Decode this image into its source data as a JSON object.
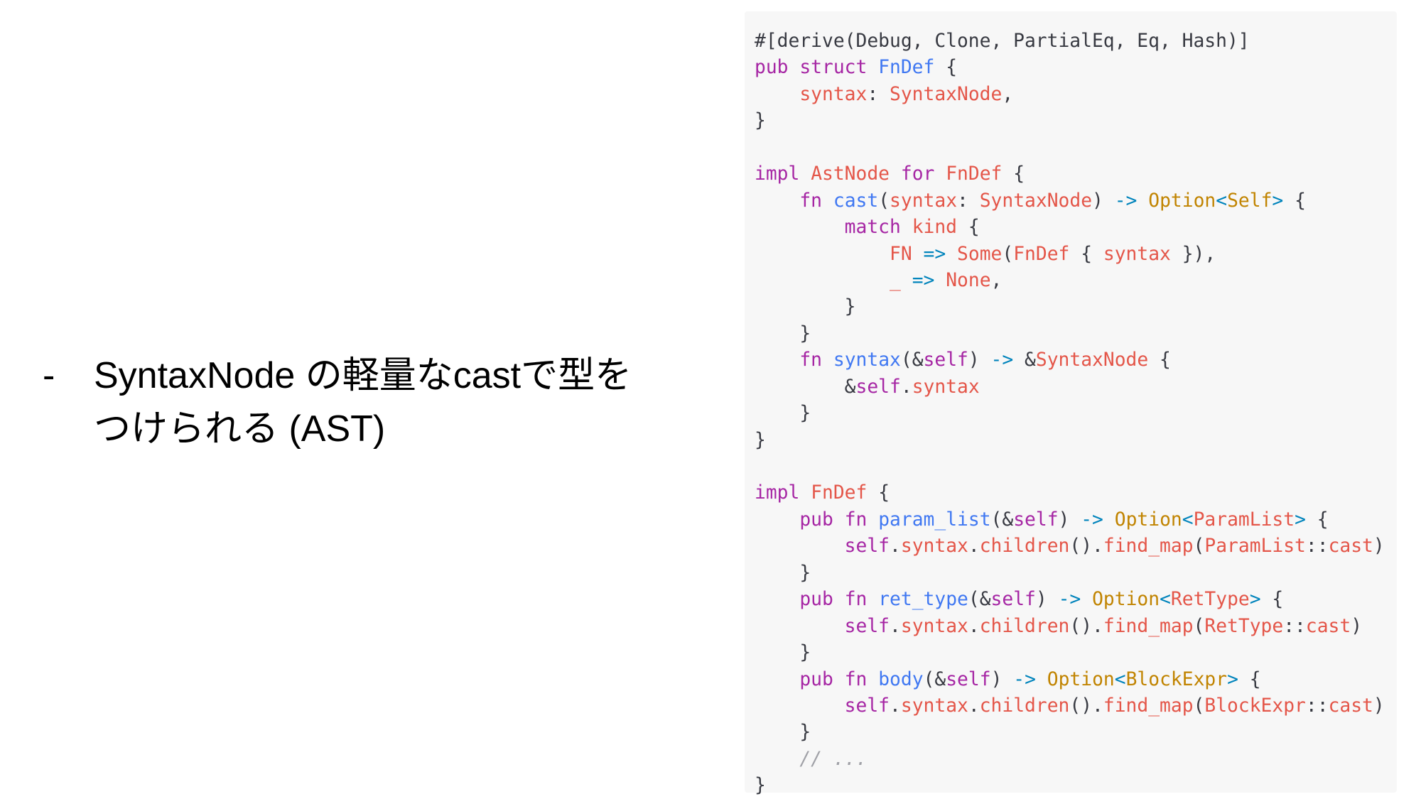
{
  "bullet": {
    "marker": "-",
    "text": "SyntaxNode の軽量なcastで型を\nつけられる (AST)"
  },
  "code": {
    "language": "rust",
    "colors": {
      "background": "#f7f7f7",
      "plain": "#383a42",
      "keyword": "#a626a4",
      "type": "#c18401",
      "ident": "#e45649",
      "func": "#4078f2",
      "op": "#0184bc",
      "comment": "#a0a1a7"
    },
    "lines": [
      [
        [
          "plain",
          "#[derive(Debug, Clone, PartialEq, Eq, Hash)]"
        ]
      ],
      [
        [
          "keyword",
          "pub"
        ],
        [
          "plain",
          " "
        ],
        [
          "keyword",
          "struct"
        ],
        [
          "plain",
          " "
        ],
        [
          "func",
          "FnDef"
        ],
        [
          "plain",
          " {"
        ]
      ],
      [
        [
          "plain",
          "    "
        ],
        [
          "ident",
          "syntax"
        ],
        [
          "plain",
          ": "
        ],
        [
          "ident",
          "SyntaxNode"
        ],
        [
          "plain",
          ","
        ]
      ],
      [
        [
          "plain",
          "}"
        ]
      ],
      [],
      [
        [
          "keyword",
          "impl"
        ],
        [
          "plain",
          " "
        ],
        [
          "ident",
          "AstNode"
        ],
        [
          "plain",
          " "
        ],
        [
          "keyword",
          "for"
        ],
        [
          "plain",
          " "
        ],
        [
          "ident",
          "FnDef"
        ],
        [
          "plain",
          " {"
        ]
      ],
      [
        [
          "plain",
          "    "
        ],
        [
          "keyword",
          "fn"
        ],
        [
          "plain",
          " "
        ],
        [
          "func",
          "cast"
        ],
        [
          "plain",
          "("
        ],
        [
          "ident",
          "syntax"
        ],
        [
          "plain",
          ": "
        ],
        [
          "ident",
          "SyntaxNode"
        ],
        [
          "plain",
          ") "
        ],
        [
          "op",
          "->"
        ],
        [
          "plain",
          " "
        ],
        [
          "type",
          "Option"
        ],
        [
          "op",
          "<"
        ],
        [
          "type",
          "Self"
        ],
        [
          "op",
          ">"
        ],
        [
          "plain",
          " {"
        ]
      ],
      [
        [
          "plain",
          "        "
        ],
        [
          "keyword",
          "match"
        ],
        [
          "plain",
          " "
        ],
        [
          "ident",
          "kind"
        ],
        [
          "plain",
          " {"
        ]
      ],
      [
        [
          "plain",
          "            "
        ],
        [
          "ident",
          "FN"
        ],
        [
          "plain",
          " "
        ],
        [
          "op",
          "=>"
        ],
        [
          "plain",
          " "
        ],
        [
          "ident",
          "Some"
        ],
        [
          "plain",
          "("
        ],
        [
          "ident",
          "FnDef"
        ],
        [
          "plain",
          " { "
        ],
        [
          "ident",
          "syntax"
        ],
        [
          "plain",
          " }),"
        ]
      ],
      [
        [
          "plain",
          "            "
        ],
        [
          "ident",
          "_"
        ],
        [
          "plain",
          " "
        ],
        [
          "op",
          "=>"
        ],
        [
          "plain",
          " "
        ],
        [
          "ident",
          "None"
        ],
        [
          "plain",
          ","
        ]
      ],
      [
        [
          "plain",
          "        }"
        ]
      ],
      [
        [
          "plain",
          "    }"
        ]
      ],
      [
        [
          "plain",
          "    "
        ],
        [
          "keyword",
          "fn"
        ],
        [
          "plain",
          " "
        ],
        [
          "func",
          "syntax"
        ],
        [
          "plain",
          "(&"
        ],
        [
          "keyword",
          "self"
        ],
        [
          "plain",
          ") "
        ],
        [
          "op",
          "->"
        ],
        [
          "plain",
          " &"
        ],
        [
          "ident",
          "SyntaxNode"
        ],
        [
          "plain",
          " {"
        ]
      ],
      [
        [
          "plain",
          "        &"
        ],
        [
          "keyword",
          "self"
        ],
        [
          "plain",
          "."
        ],
        [
          "ident",
          "syntax"
        ]
      ],
      [
        [
          "plain",
          "    }"
        ]
      ],
      [
        [
          "plain",
          "}"
        ]
      ],
      [],
      [
        [
          "keyword",
          "impl"
        ],
        [
          "plain",
          " "
        ],
        [
          "ident",
          "FnDef"
        ],
        [
          "plain",
          " {"
        ]
      ],
      [
        [
          "plain",
          "    "
        ],
        [
          "keyword",
          "pub"
        ],
        [
          "plain",
          " "
        ],
        [
          "keyword",
          "fn"
        ],
        [
          "plain",
          " "
        ],
        [
          "func",
          "param_list"
        ],
        [
          "plain",
          "(&"
        ],
        [
          "keyword",
          "self"
        ],
        [
          "plain",
          ") "
        ],
        [
          "op",
          "->"
        ],
        [
          "plain",
          " "
        ],
        [
          "type",
          "Option"
        ],
        [
          "op",
          "<"
        ],
        [
          "ident",
          "ParamList"
        ],
        [
          "op",
          ">"
        ],
        [
          "plain",
          " {"
        ]
      ],
      [
        [
          "plain",
          "        "
        ],
        [
          "keyword",
          "self"
        ],
        [
          "plain",
          "."
        ],
        [
          "ident",
          "syntax"
        ],
        [
          "plain",
          "."
        ],
        [
          "ident",
          "children"
        ],
        [
          "plain",
          "()."
        ],
        [
          "ident",
          "find_map"
        ],
        [
          "plain",
          "("
        ],
        [
          "ident",
          "ParamList"
        ],
        [
          "plain",
          "::"
        ],
        [
          "ident",
          "cast"
        ],
        [
          "plain",
          ")"
        ]
      ],
      [
        [
          "plain",
          "    }"
        ]
      ],
      [
        [
          "plain",
          "    "
        ],
        [
          "keyword",
          "pub"
        ],
        [
          "plain",
          " "
        ],
        [
          "keyword",
          "fn"
        ],
        [
          "plain",
          " "
        ],
        [
          "func",
          "ret_type"
        ],
        [
          "plain",
          "(&"
        ],
        [
          "keyword",
          "self"
        ],
        [
          "plain",
          ") "
        ],
        [
          "op",
          "->"
        ],
        [
          "plain",
          " "
        ],
        [
          "type",
          "Option"
        ],
        [
          "op",
          "<"
        ],
        [
          "ident",
          "RetType"
        ],
        [
          "op",
          ">"
        ],
        [
          "plain",
          " {"
        ]
      ],
      [
        [
          "plain",
          "        "
        ],
        [
          "keyword",
          "self"
        ],
        [
          "plain",
          "."
        ],
        [
          "ident",
          "syntax"
        ],
        [
          "plain",
          "."
        ],
        [
          "ident",
          "children"
        ],
        [
          "plain",
          "()."
        ],
        [
          "ident",
          "find_map"
        ],
        [
          "plain",
          "("
        ],
        [
          "ident",
          "RetType"
        ],
        [
          "plain",
          "::"
        ],
        [
          "ident",
          "cast"
        ],
        [
          "plain",
          ")"
        ]
      ],
      [
        [
          "plain",
          "    }"
        ]
      ],
      [
        [
          "plain",
          "    "
        ],
        [
          "keyword",
          "pub"
        ],
        [
          "plain",
          " "
        ],
        [
          "keyword",
          "fn"
        ],
        [
          "plain",
          " "
        ],
        [
          "func",
          "body"
        ],
        [
          "plain",
          "(&"
        ],
        [
          "keyword",
          "self"
        ],
        [
          "plain",
          ") "
        ],
        [
          "op",
          "->"
        ],
        [
          "plain",
          " "
        ],
        [
          "type",
          "Option"
        ],
        [
          "op",
          "<"
        ],
        [
          "type",
          "BlockExpr"
        ],
        [
          "op",
          ">"
        ],
        [
          "plain",
          " {"
        ]
      ],
      [
        [
          "plain",
          "        "
        ],
        [
          "keyword",
          "self"
        ],
        [
          "plain",
          "."
        ],
        [
          "ident",
          "syntax"
        ],
        [
          "plain",
          "."
        ],
        [
          "ident",
          "children"
        ],
        [
          "plain",
          "()."
        ],
        [
          "ident",
          "find_map"
        ],
        [
          "plain",
          "("
        ],
        [
          "ident",
          "BlockExpr"
        ],
        [
          "plain",
          "::"
        ],
        [
          "ident",
          "cast"
        ],
        [
          "plain",
          ")"
        ]
      ],
      [
        [
          "plain",
          "    }"
        ]
      ],
      [
        [
          "plain",
          "    "
        ],
        [
          "comment",
          "// ..."
        ]
      ],
      [
        [
          "plain",
          "}"
        ]
      ]
    ]
  }
}
